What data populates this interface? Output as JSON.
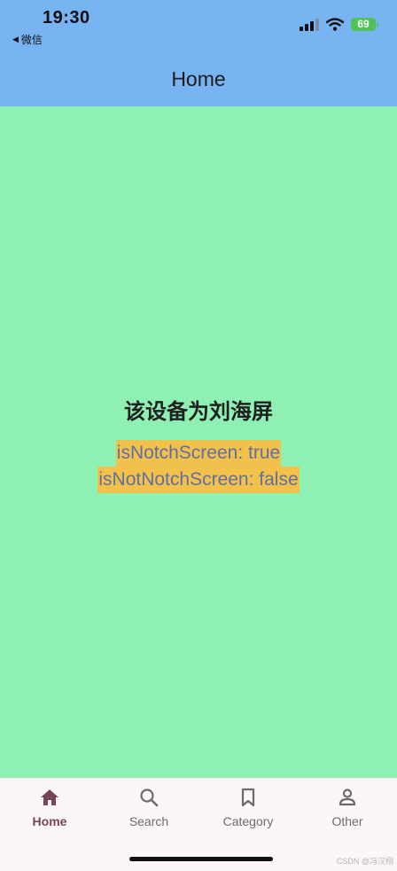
{
  "status_bar": {
    "time": "19:30",
    "back_label": "微信",
    "battery": "69"
  },
  "app_bar": {
    "title": "Home"
  },
  "content": {
    "heading": "该设备为刘海屏",
    "line1": "isNotchScreen: true",
    "line2": "isNotNotchScreen: false"
  },
  "bottom_nav": {
    "items": [
      {
        "label": "Home",
        "icon": "home-icon",
        "active": true
      },
      {
        "label": "Search",
        "icon": "search-icon",
        "active": false
      },
      {
        "label": "Category",
        "icon": "bookmark-icon",
        "active": false
      },
      {
        "label": "Other",
        "icon": "person-icon",
        "active": false
      }
    ]
  },
  "watermark": "CSDN @冯汉栩",
  "colors": {
    "app_bar": "#78b3f2",
    "content_bg": "#8ff0b3",
    "highlight": "#f2c14b",
    "highlight_text": "#5f6fa5",
    "nav_active": "#7a4357",
    "nav_inactive": "#6b6b6b",
    "nav_bg": "#fcf6f6"
  }
}
